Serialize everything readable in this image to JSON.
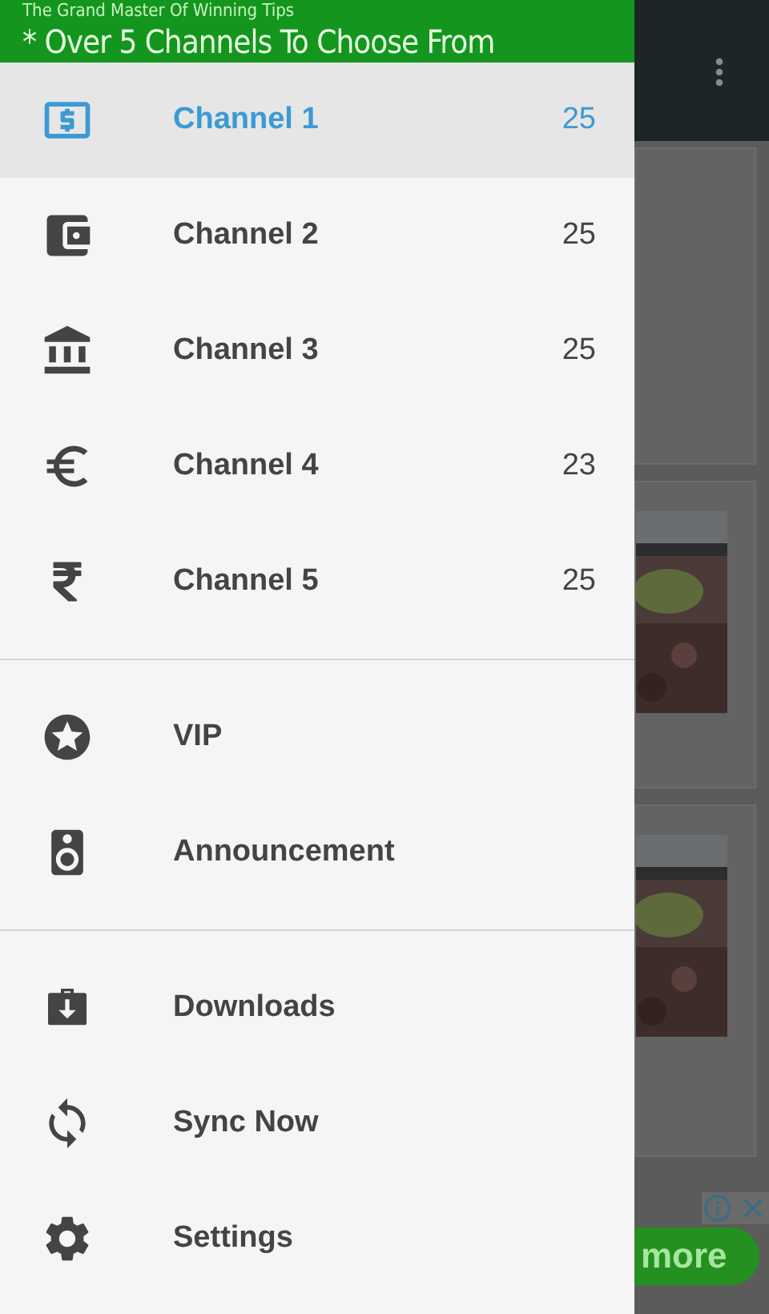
{
  "drawer": {
    "tagline": "The Grand Master Of Winning Tips",
    "header": "* Over 5 Channels To Choose From",
    "sections": [
      {
        "items": [
          {
            "label": "Channel 1",
            "count": "25",
            "selected": true
          },
          {
            "label": "Channel 2",
            "count": "25",
            "selected": false
          },
          {
            "label": "Channel 3",
            "count": "25",
            "selected": false
          },
          {
            "label": "Channel 4",
            "count": "23",
            "selected": false
          },
          {
            "label": "Channel 5",
            "count": "25",
            "selected": false
          }
        ]
      },
      {
        "items": [
          {
            "label": "VIP",
            "selected": false
          },
          {
            "label": "Announcement",
            "selected": false
          }
        ]
      },
      {
        "items": [
          {
            "label": "Downloads",
            "selected": false
          },
          {
            "label": "Sync Now",
            "selected": false
          },
          {
            "label": "Settings",
            "selected": false
          }
        ]
      }
    ]
  },
  "background": {
    "cards": [
      {
        "kind": "text"
      },
      {
        "kind": "picture"
      },
      {
        "kind": "picture"
      }
    ],
    "ad_button": "more"
  }
}
